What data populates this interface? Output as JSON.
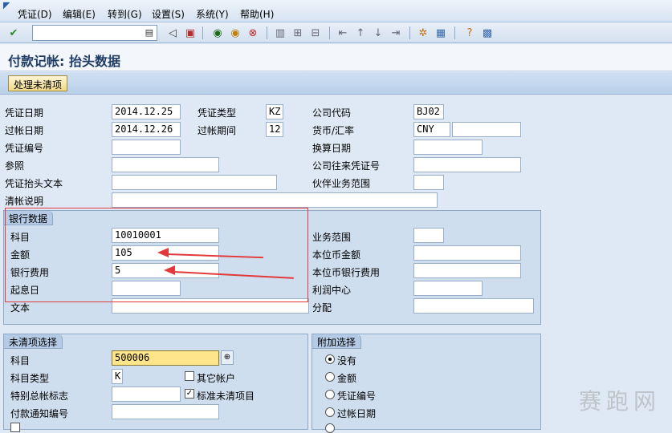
{
  "menu": {
    "items": [
      "凭证(D)",
      "编辑(E)",
      "转到(G)",
      "设置(S)",
      "系统(Y)",
      "帮助(H)"
    ]
  },
  "toolbar": {
    "command_field": "",
    "icons": [
      "check-icon",
      "back-icon",
      "save-icon",
      "nav-back-icon",
      "exit-icon",
      "cancel-icon",
      "print-icon",
      "find-icon",
      "find-next-icon",
      "first-page-icon",
      "prev-page-icon",
      "next-page-icon",
      "last-page-icon",
      "new-session-icon",
      "shortcut-icon",
      "help-icon",
      "layout-icon"
    ]
  },
  "title": "付款记帐: 抬头数据",
  "app_toolbar": {
    "process_open_items": "处理未清项"
  },
  "header": {
    "doc_date_label": "凭证日期",
    "doc_date": "2014.12.25",
    "doc_type_label": "凭证类型",
    "doc_type": "KZ",
    "company_code_label": "公司代码",
    "company_code": "BJ02",
    "posting_date_label": "过帐日期",
    "posting_date": "2014.12.26",
    "period_label": "过帐期间",
    "period": "12",
    "currency_label": "货币/汇率",
    "currency": "CNY",
    "rate": "",
    "doc_no_label": "凭证编号",
    "doc_no": "",
    "translation_date_label": "换算日期",
    "translation_date": "",
    "reference_label": "参照",
    "reference": "",
    "intercompany_label": "公司往来凭证号",
    "intercompany": "",
    "header_text_label": "凭证抬头文本",
    "header_text": "",
    "partner_ba_label": "伙伴业务范围",
    "partner_ba": "",
    "clearing_text_label": "清帐说明",
    "clearing_text": ""
  },
  "bank": {
    "group_title": "银行数据",
    "account_label": "科目",
    "account": "10010001",
    "business_area_label": "业务范围",
    "business_area": "",
    "amount_label": "金额",
    "amount": "105",
    "local_amount_label": "本位币金额",
    "local_amount": "",
    "charges_label": "银行费用",
    "charges": "5",
    "local_charges_label": "本位币银行费用",
    "local_charges": "",
    "value_date_label": "起息日",
    "value_date": "",
    "profit_center_label": "利润中心",
    "profit_center": "",
    "text_label": "文本",
    "text": "",
    "assignment_label": "分配",
    "assignment": ""
  },
  "open_items": {
    "group_title": "未清项选择",
    "account_label": "科目",
    "account": "500006",
    "account_type_label": "科目类型",
    "account_type": "K",
    "other_accounts_label": "其它帐户",
    "special_gl_label": "特别总帐标志",
    "special_gl": "",
    "standard_oi_label": "标准未清项目",
    "payment_advice_label": "付款通知编号",
    "payment_advice": ""
  },
  "additional": {
    "group_title": "附加选择",
    "options": [
      "没有",
      "金额",
      "凭证编号",
      "过帐日期"
    ]
  },
  "watermark": "赛跑网"
}
